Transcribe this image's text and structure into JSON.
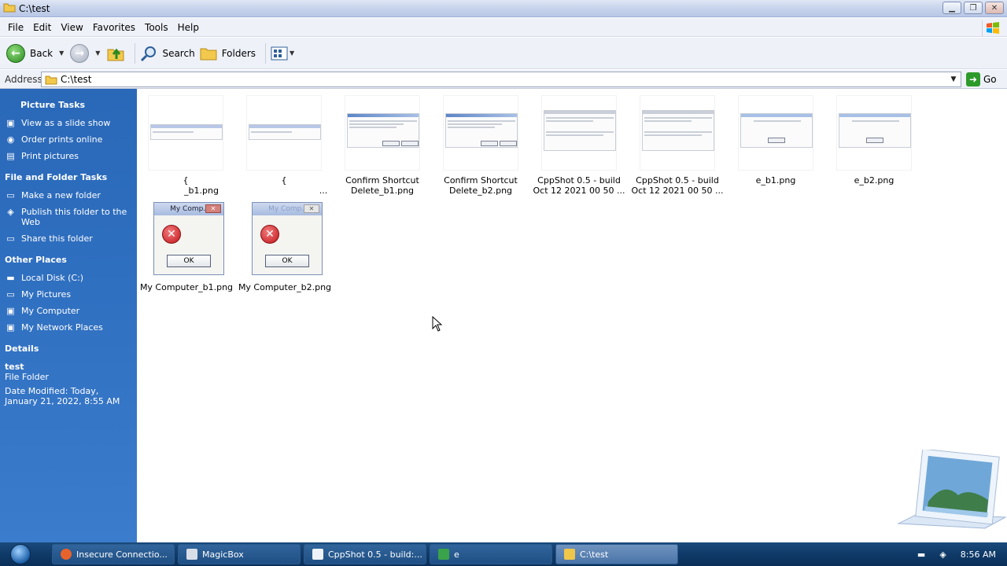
{
  "window": {
    "title": "C:\\test"
  },
  "menubar": {
    "items": [
      "File",
      "Edit",
      "View",
      "Favorites",
      "Tools",
      "Help"
    ]
  },
  "toolbar": {
    "back_label": "Back",
    "search_label": "Search",
    "folders_label": "Folders"
  },
  "address": {
    "label": "Address",
    "value": "C:\\test",
    "go_label": "Go"
  },
  "sidebar": {
    "picture_tasks": {
      "title": "Picture Tasks",
      "items": [
        "View as a slide show",
        "Order prints online",
        "Print pictures"
      ]
    },
    "file_folder_tasks": {
      "title": "File and Folder Tasks",
      "items": [
        "Make a new folder",
        "Publish this folder to the Web",
        "Share this folder"
      ]
    },
    "other_places": {
      "title": "Other Places",
      "items": [
        "Local Disk (C:)",
        "My Pictures",
        "My Computer",
        "My Network Places"
      ]
    },
    "details": {
      "title": "Details",
      "name": "test",
      "type": "File Folder",
      "modified": "Date Modified: Today, January 21, 2022, 8:55 AM"
    }
  },
  "files": [
    {
      "line1": "{",
      "line2": "_b1.png"
    },
    {
      "line1": "{",
      "line2": "..."
    },
    {
      "line1": "Confirm Shortcut",
      "line2": "Delete_b1.png"
    },
    {
      "line1": "Confirm Shortcut",
      "line2": "Delete_b2.png"
    },
    {
      "line1": "CppShot 0.5 - build",
      "line2": "Oct 12 2021 00 50 ..."
    },
    {
      "line1": "CppShot 0.5 - build",
      "line2": "Oct 12 2021 00 50 ..."
    },
    {
      "line1": "e_b1.png",
      "line2": ""
    },
    {
      "line1": "e_b2.png",
      "line2": ""
    },
    {
      "line1": "My Computer_b1.png",
      "line2": "",
      "dialog_title": "My Comp...",
      "ok": "OK"
    },
    {
      "line1": "My Computer_b2.png",
      "line2": "",
      "dialog_title": "My Comp...",
      "ok": "OK"
    }
  ],
  "taskbar": {
    "buttons": [
      {
        "label": "Insecure Connectio...",
        "icon_color": "#e8632c"
      },
      {
        "label": "MagicBox",
        "icon_color": "#d8dee8"
      },
      {
        "label": "CppShot 0.5 - build:...",
        "icon_color": "#eef2f8"
      },
      {
        "label": "e",
        "icon_color": "#3aa24a"
      },
      {
        "label": "C:\\test",
        "icon_color": "#f0c64a"
      }
    ],
    "clock": "8:56 AM"
  }
}
